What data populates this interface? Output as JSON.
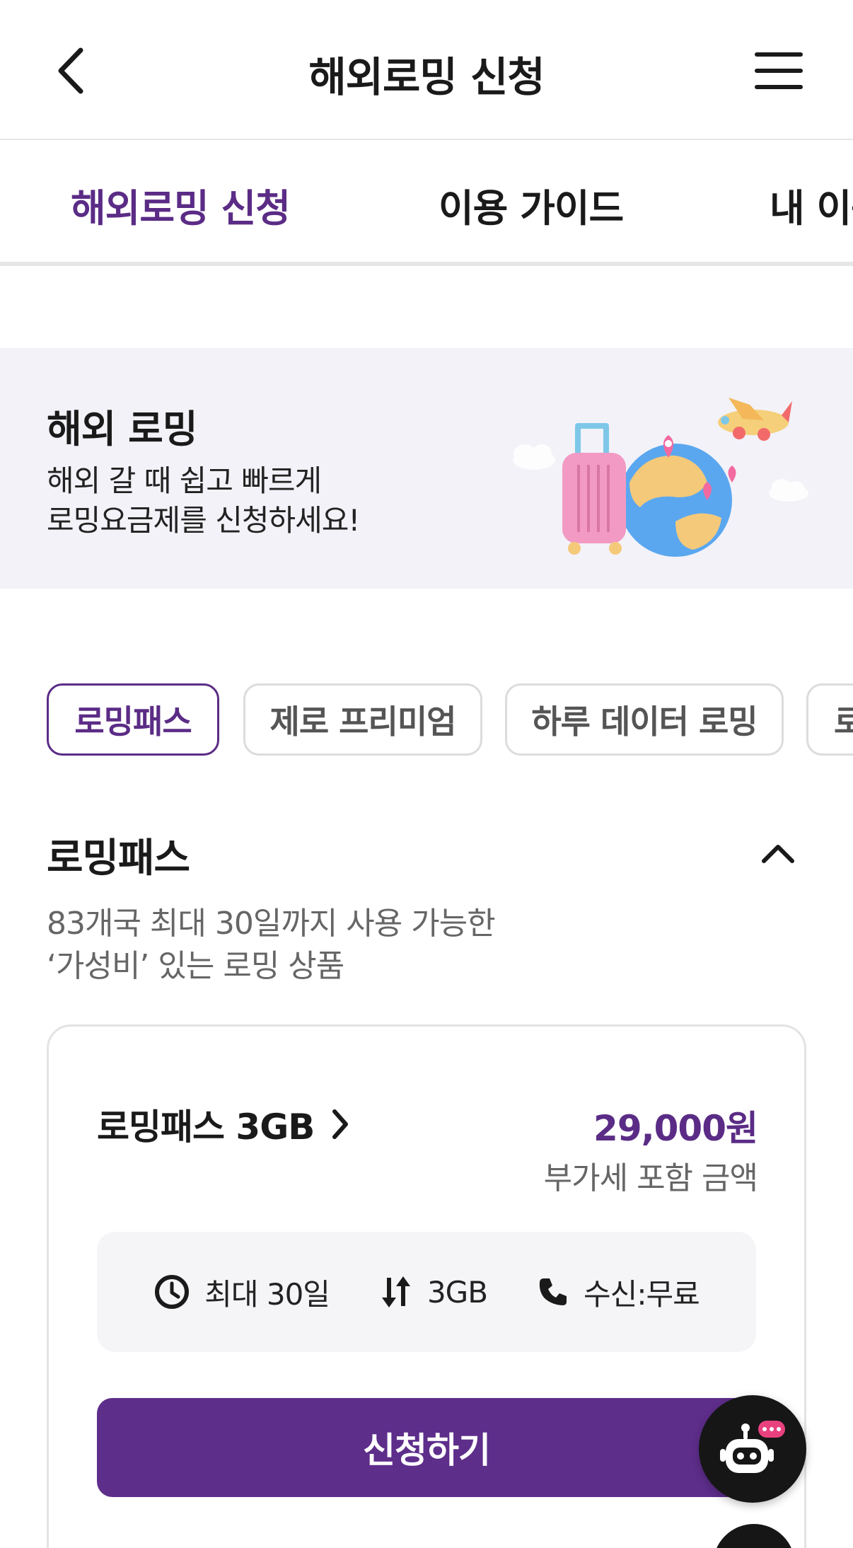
{
  "header": {
    "title": "해외로밍 신청"
  },
  "tabs": [
    {
      "label": "해외로밍 신청",
      "active": true
    },
    {
      "label": "이용 가이드",
      "active": false
    },
    {
      "label": "내 이용",
      "active": false
    }
  ],
  "banner": {
    "title": "해외 로밍",
    "subtitle_line1": "해외 갈 때 쉽고 빠르게",
    "subtitle_line2": "로밍요금제를 신청하세요!"
  },
  "chips": [
    {
      "label": "로밍패스",
      "active": true
    },
    {
      "label": "제로 프리미엄",
      "active": false
    },
    {
      "label": "하루 데이터 로밍",
      "active": false
    },
    {
      "label": "로",
      "active": false
    }
  ],
  "section": {
    "title": "로밍패스",
    "desc_line1": "83개국 최대 30일까지 사용 가능한",
    "desc_line2": "‘가성비’ 있는 로밍 상품"
  },
  "card": {
    "plan_name": "로밍패스 3GB",
    "price": "29,000원",
    "price_note": "부가세 포함 금액",
    "features": {
      "duration": "최대 30일",
      "data": "3GB",
      "call": "수신:무료"
    },
    "apply_label": "신청하기"
  },
  "colors": {
    "accent": "#5b2c86",
    "button": "#5e2e8b",
    "banner_bg": "#f2f2f8"
  }
}
